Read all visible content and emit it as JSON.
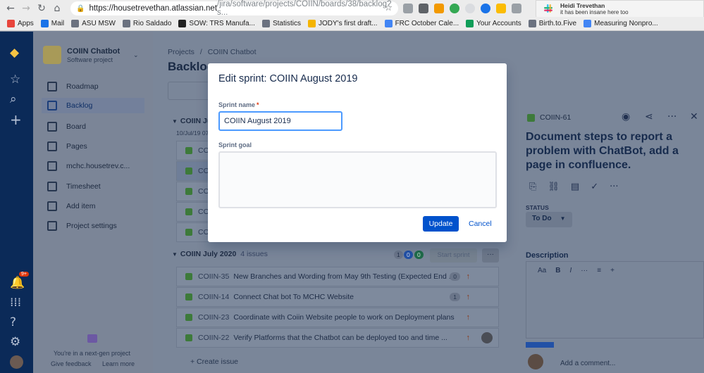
{
  "browser": {
    "url_host": "https://housetrevethan.atlassian.net",
    "url_path": "/jira/software/projects/COIIN/boards/38/backlog?s...",
    "bookmarks": [
      "Apps",
      "Mail",
      "ASU MSW",
      "Rio Saldado",
      "SOW: TRS Manufa...",
      "Statistics",
      "JODY's first draft...",
      "FRC October Cale...",
      "Your Accounts",
      "Birth.to.Five",
      "Measuring Nonpro..."
    ],
    "bookmark_colors": [
      "#e8453c",
      "#1a73e8",
      "#6b7280",
      "#6b7280",
      "#222222",
      "#6b7280",
      "#f4b400",
      "#4285f4",
      "#0f9d58",
      "#6b7280",
      "#4285f4"
    ],
    "notification": {
      "title": "Heidi Trevethan",
      "message": "it has been insane here too"
    }
  },
  "rail": {
    "notification_count": "9+"
  },
  "sidebar": {
    "project_name": "COIIN Chatbot",
    "project_type": "Software project",
    "items": [
      {
        "label": "Roadmap"
      },
      {
        "label": "Backlog"
      },
      {
        "label": "Board"
      },
      {
        "label": "Pages"
      },
      {
        "label": "mchc.housetrev.c..."
      },
      {
        "label": "Timesheet"
      },
      {
        "label": "Add item"
      },
      {
        "label": "Project settings"
      }
    ],
    "footer_text": "You're in a next-gen project",
    "feedback_label": "Give feedback",
    "learn_more_label": "Learn more"
  },
  "main": {
    "breadcrumb_projects": "Projects",
    "breadcrumb_sep": "/",
    "breadcrumb_project": "COIIN Chatbot",
    "page_title": "Backlog",
    "sprint1": {
      "name": "COIIN Ju",
      "dates": "10/Jul/19 07",
      "rows": [
        "COI",
        "COI",
        "COI",
        "COI",
        "COI"
      ]
    },
    "sprint2": {
      "name": "COIIN July 2020",
      "count": "4 issues",
      "pills": [
        "1",
        "0",
        "0"
      ],
      "start_label": "Start sprint",
      "issues": [
        {
          "key": "COIIN-35",
          "summary": "New Branches and Wording from May 9th Testing (Expected End ...",
          "badge": "0"
        },
        {
          "key": "COIIN-14",
          "summary": "Connect Chat bot To MCHC Website",
          "badge": "1"
        },
        {
          "key": "COIIN-23",
          "summary": "Coordinate with Coiin Website people to work on Deployment plans",
          "badge": ""
        },
        {
          "key": "COIIN-22",
          "summary": "Verify Platforms that the Chatbot can be deployed too and time ...",
          "badge": ""
        }
      ]
    },
    "create_issue_label": "+ Create issue"
  },
  "detail": {
    "issue_key": "COIIN-61",
    "title": "Document steps to report a problem with ChatBot, add a page in confluence.",
    "status_label": "STATUS",
    "status_value": "To Do",
    "description_label": "Description",
    "toolbar": [
      "Aa",
      "B",
      "I",
      "···",
      "≡",
      "+"
    ],
    "comment_placeholder": "Add a comment..."
  },
  "modal": {
    "title": "Edit sprint: COIIN August 2019",
    "sprint_name_label": "Sprint name",
    "sprint_name_value": "COIIN August 2019",
    "sprint_goal_label": "Sprint goal",
    "sprint_goal_value": "",
    "update_label": "Update",
    "cancel_label": "Cancel"
  }
}
